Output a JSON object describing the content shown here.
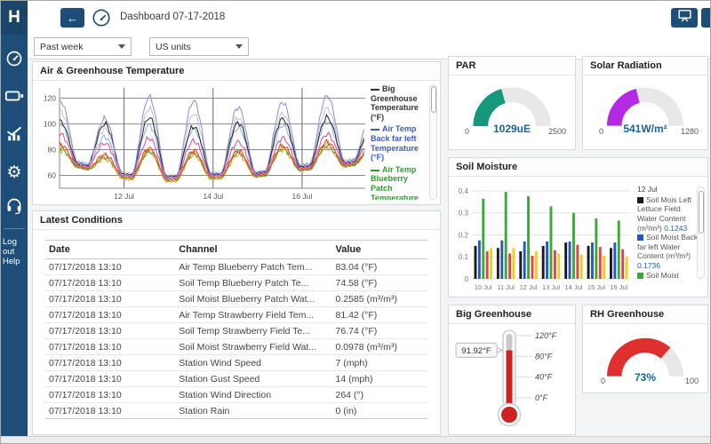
{
  "titlebar": {
    "title": "Dashboard 07-17-2018"
  },
  "sidebar": {
    "logo": "H",
    "items": [
      {
        "icon": "dashboard-gauge-icon"
      },
      {
        "icon": "device-battery-icon"
      },
      {
        "icon": "channels-chart-icon"
      },
      {
        "icon": "settings-gear-icon"
      },
      {
        "icon": "support-headset-icon"
      }
    ],
    "logout_label": "Log out",
    "help_label": "Help"
  },
  "filters": {
    "time_range_value": "Past week",
    "units_value": "US units"
  },
  "panels": {
    "temperature": {
      "title": "Air & Greenhouse Temperature"
    },
    "latest_conditions": {
      "title": "Latest Conditions",
      "columns": {
        "date": "Date",
        "channel": "Channel",
        "value": "Value"
      },
      "rows": [
        [
          "07/17/2018 13:10",
          "Air Temp Blueberry Patch Tem...",
          "83.04 (°F)"
        ],
        [
          "07/17/2018 13:10",
          "Soil Temp Blueberry Patch Te...",
          "74.58 (°F)"
        ],
        [
          "07/17/2018 13:10",
          "Soil Moist Blueberry Patch Wat...",
          "0.2585 (m³/m³)"
        ],
        [
          "07/17/2018 13:10",
          "Air Temp Strawberry Field Tem...",
          "81.42 (°F)"
        ],
        [
          "07/17/2018 13:10",
          "Soil Temp Strawberry Field Te...",
          "76.74 (°F)"
        ],
        [
          "07/17/2018 13:10",
          "Soil Moist Strawberry Field Wat...",
          "0.0978 (m³/m³)"
        ],
        [
          "07/17/2018 13:10",
          "Station Wind Speed",
          "7 (mph)"
        ],
        [
          "07/17/2018 13:10",
          "Station Gust Speed",
          "14 (mph)"
        ],
        [
          "07/17/2018 13:10",
          "Station Wind Direction",
          "264 (°)"
        ],
        [
          "07/17/2018 13:10",
          "Station Rain",
          "0 (in)"
        ]
      ]
    },
    "par": {
      "title": "PAR"
    },
    "solar_radiation": {
      "title": "Solar Radiation"
    },
    "soil_moisture": {
      "title": "Soil Moisture"
    },
    "big_greenhouse": {
      "title": "Big Greenhouse"
    },
    "rh_greenhouse": {
      "title": "RH Greenhouse"
    }
  },
  "chart_data": [
    {
      "type": "line",
      "title": "Air & Greenhouse Temperature",
      "ylabel": "°F",
      "x_range": [
        10.55,
        17.42
      ],
      "y_range": [
        50,
        128
      ],
      "y_ticks": [
        60,
        80,
        100,
        120
      ],
      "x_ticks": [
        {
          "x": 12,
          "label": "12 Jul"
        },
        {
          "x": 14,
          "label": "14 Jul"
        },
        {
          "x": 16,
          "label": "16 Jul"
        }
      ],
      "legend": [
        {
          "color": "#333333",
          "label": "Big Greenhouse Temperature (°F)"
        },
        {
          "color": "#3b5bc4",
          "label": "Air Temp Back far left Temperature (°F)"
        },
        {
          "color": "#2ca02c",
          "label": "Air Temp Blueberry Patch Temperature (°F)"
        }
      ],
      "series": [
        {
          "name": "",
          "color": "#c0c0c8",
          "peaks": [
            110,
            96,
            112,
            108,
            105,
            108,
            112,
            100
          ],
          "valleys": [
            73,
            71,
            62,
            60,
            62,
            63,
            69,
            72,
            78
          ]
        },
        {
          "name": "",
          "color": "#cfa81f",
          "peaks": [
            80,
            73,
            78,
            76,
            76,
            80,
            82,
            79
          ],
          "valleys": [
            68,
            66,
            57,
            55,
            57,
            59,
            64,
            67,
            72
          ]
        },
        {
          "name": "Air Temp Blueberry Patch Temperature (°F)",
          "color": "#3d9a35",
          "peaks": [
            81,
            74,
            79,
            77,
            78,
            81,
            83,
            80
          ],
          "valleys": [
            68,
            66,
            58,
            56,
            58,
            59,
            64,
            67,
            72
          ]
        },
        {
          "name": "",
          "color": "#e8922e",
          "peaks": [
            83,
            75,
            80,
            78,
            78,
            82,
            85,
            81
          ],
          "valleys": [
            69,
            67,
            58,
            56,
            58,
            60,
            65,
            68,
            73
          ]
        },
        {
          "name": "",
          "color": "#d0482c",
          "peaks": [
            84,
            76,
            81,
            79,
            79,
            83,
            86,
            82
          ],
          "valleys": [
            69,
            67,
            59,
            57,
            59,
            60,
            65,
            68,
            73
          ]
        },
        {
          "name": "",
          "color": "#7fb3dc",
          "peaks": [
            100,
            90,
            99,
            96,
            97,
            99,
            102,
            95
          ],
          "valleys": [
            70,
            68,
            60,
            58,
            60,
            61,
            66,
            69,
            75
          ]
        },
        {
          "name": "",
          "color": "#e8439c",
          "peaks": [
            92,
            85,
            89,
            87,
            86,
            89,
            92,
            88
          ],
          "valleys": [
            70,
            68,
            60,
            58,
            60,
            61,
            66,
            69,
            74
          ]
        },
        {
          "name": "Big Greenhouse Temperature (°F)",
          "color": "#222222",
          "peaks": [
            102,
            100,
            105,
            98,
            101,
            104,
            105,
            98
          ],
          "valleys": [
            71,
            69,
            61,
            59,
            61,
            62,
            67,
            70,
            76
          ]
        },
        {
          "name": "Air Temp Back far left Temperature (°F)",
          "color": "#8a8ae0",
          "peaks": [
            118,
            104,
            121,
            118,
            113,
            117,
            122,
            108
          ],
          "valleys": [
            72,
            70,
            60,
            58,
            61,
            62,
            68,
            71,
            78
          ]
        }
      ]
    },
    {
      "type": "bar",
      "title": "Soil Moisture",
      "ylabel": "m³/m³",
      "categories": [
        "10 Jul",
        "11 Jul",
        "12 Jul",
        "13 Jul",
        "14 Jul",
        "15 Jul",
        "16 Jul"
      ],
      "y_ticks": [
        0,
        0.1,
        0.2,
        0.3,
        0.4
      ],
      "y_max": 0.42,
      "series": [
        {
          "name": "Soil Mois Left Lettuce Field Water Content (m³/m³)",
          "color": "#1a1a1a",
          "values": [
            0.15,
            0.14,
            0.125,
            0.15,
            0.165,
            0.15,
            0.14
          ]
        },
        {
          "name": "Soil Moist Back far left Water Content (m³/m³)",
          "color": "#2458c4",
          "values": [
            0.175,
            0.175,
            0.17,
            0.17,
            0.17,
            0.165,
            0.165
          ]
        },
        {
          "name": "Soil Moist",
          "color": "#3aaa35",
          "values": [
            0.365,
            0.395,
            0.375,
            0.33,
            0.3,
            0.275,
            0.265
          ]
        },
        {
          "name": "",
          "color": "#e8414b",
          "values": [
            0.125,
            0.115,
            0.105,
            0.13,
            0.155,
            0.145,
            0.135
          ]
        },
        {
          "name": "",
          "color": "#f0cf1f",
          "values": [
            0.14,
            0.14,
            0.125,
            0.115,
            0.11,
            0.105,
            0.1
          ]
        }
      ],
      "tooltip": {
        "date": "12 Jul",
        "entries": [
          {
            "color": "#1a1a1a",
            "text": "Soil Mois Left Lettuce Field Water Content (m³/m³)",
            "value": "0.1243"
          },
          {
            "color": "#2458c4",
            "text": "Soil Moist Back far left Water Content (m³/m³)",
            "value": "0.1736"
          },
          {
            "color": "#3aaa35",
            "text": "Soil Moist",
            "value": ""
          }
        ]
      }
    },
    {
      "type": "gauge",
      "title": "PAR",
      "value": 1029,
      "min": 0,
      "max": 2500,
      "label": "1029uE",
      "color": "#17977c"
    },
    {
      "type": "gauge",
      "title": "Solar Radiation",
      "value": 541,
      "min": 0,
      "max": 1280,
      "label": "541W/m²",
      "color": "#b429e3"
    },
    {
      "type": "gauge",
      "title": "RH Greenhouse",
      "value": 73,
      "min": 0,
      "max": 100,
      "label": "73%",
      "color": "#df2f2f"
    },
    {
      "type": "thermometer",
      "title": "Big Greenhouse",
      "value": 91.92,
      "min": 0,
      "max": 120,
      "label": "91.92°F",
      "ticks": [
        "120°F",
        "80°F",
        "40°F",
        "0°F"
      ]
    }
  ]
}
